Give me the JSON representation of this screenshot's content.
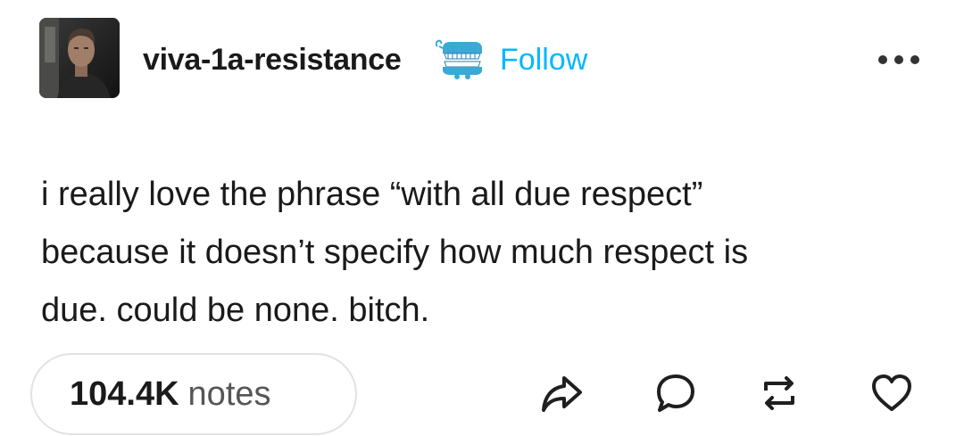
{
  "post": {
    "author": {
      "username": "viva-1a-resistance",
      "follow_label": "Follow"
    },
    "text": "i really love the phrase “with all due respect”\nbecause it doesn’t specify how much respect is\ndue. could be none. bitch.",
    "notes": {
      "count": "104.4K",
      "label": "notes"
    }
  },
  "icons": {
    "avatar": "user-photo",
    "badge": "chattering-teeth-badge",
    "more": "ellipsis-icon",
    "share": "share-arrow-icon",
    "reply": "speech-bubble-icon",
    "reblog": "reblog-arrows-icon",
    "like": "heart-outline-icon"
  },
  "colors": {
    "follow": "#00b8ff",
    "text": "#1a1a1a",
    "notes_border": "#e2e2e2",
    "badge": "#2fa8d8"
  }
}
